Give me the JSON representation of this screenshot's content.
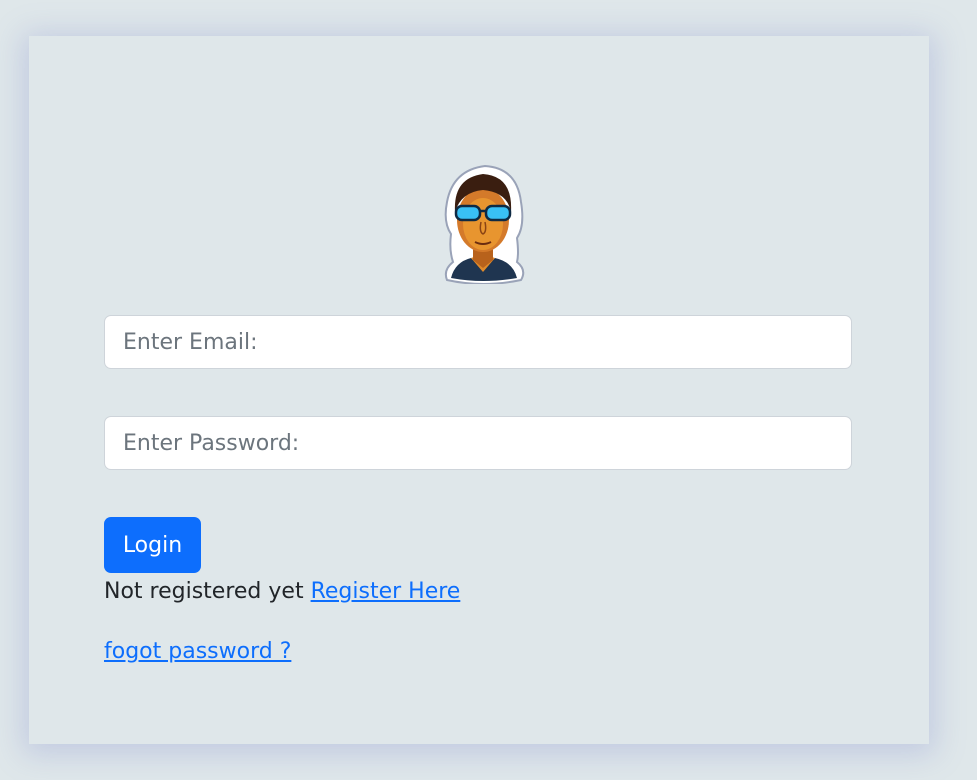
{
  "login_form": {
    "avatar_icon": "sunglasses-man-avatar-icon",
    "email": {
      "placeholder": "Enter Email:",
      "value": ""
    },
    "password": {
      "placeholder": "Enter Password:",
      "value": ""
    },
    "login_label": "Login",
    "register_prompt": "Not registered yet",
    "register_link": "Register Here",
    "forgot_link": "fogot password ?"
  },
  "colors": {
    "background": "#dfe7ea",
    "primary": "#0d6efd",
    "text": "#212529",
    "placeholder": "#6c757d"
  }
}
